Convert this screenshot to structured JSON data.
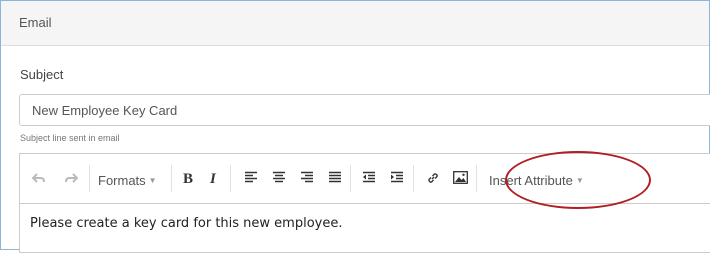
{
  "panel": {
    "title": "Email"
  },
  "subject": {
    "label": "Subject",
    "value": "New Employee Key Card",
    "help": "Subject line sent in email"
  },
  "toolbar": {
    "formats_label": "Formats",
    "bold_label": "B",
    "italic_label": "I",
    "insert_attribute_label": "Insert Attribute"
  },
  "editor": {
    "content": "Please create a key card for this new employee."
  },
  "colors": {
    "frame_border": "#8fb3d9",
    "highlight": "#b11f24"
  }
}
